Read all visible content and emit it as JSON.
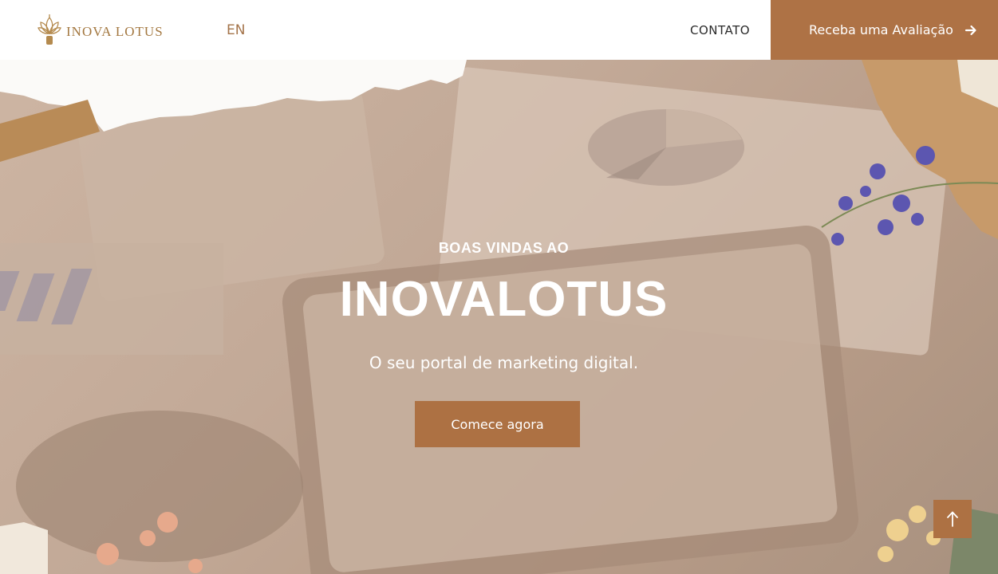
{
  "header": {
    "logo_text": "INOVA LOTUS",
    "logo_icon": "lotus-icon",
    "language": "EN",
    "nav_contact": "CONTATO",
    "cta_label": "Receba uma Avaliação",
    "cta_icon": "arrow-right-icon"
  },
  "hero": {
    "eyebrow": "BOAS VINDAS AO",
    "title": "INOVALOTUS",
    "subtitle": "O seu portal de marketing digital.",
    "button_label": "Comece agora"
  },
  "scroll_top": {
    "icon": "arrow-up-icon"
  },
  "colors": {
    "accent": "#ad7143",
    "logo": "#a3773f",
    "hero_overlay": "#c3aa97"
  }
}
